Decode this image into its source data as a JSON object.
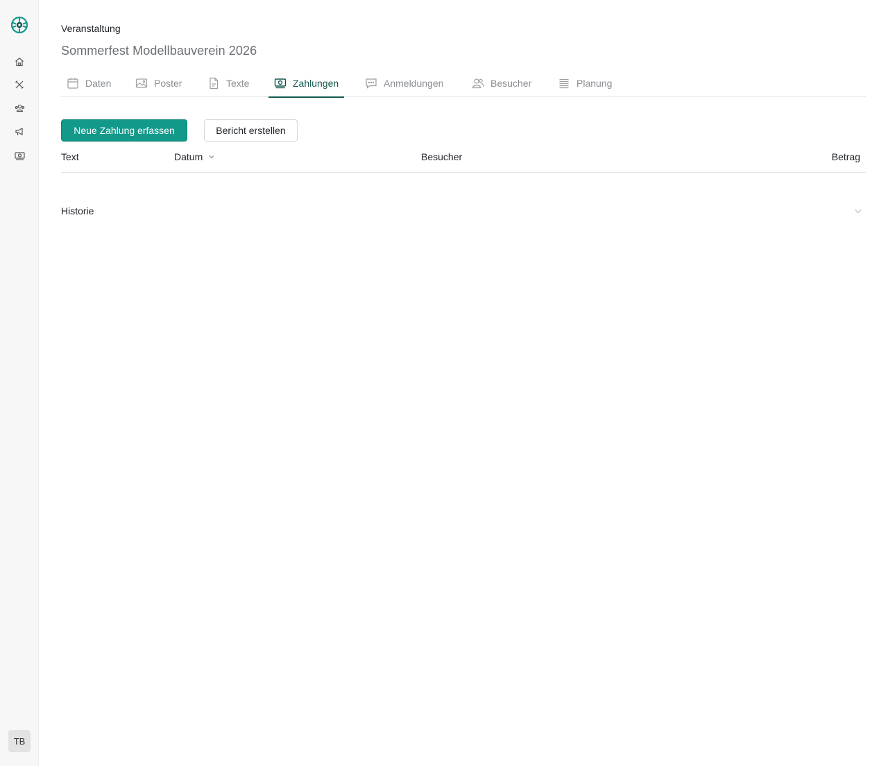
{
  "sidebar": {
    "logo": "brand-logo-icon",
    "nav": [
      {
        "name": "home-icon"
      },
      {
        "name": "tools-icon"
      },
      {
        "name": "users-icon"
      },
      {
        "name": "megaphone-icon"
      },
      {
        "name": "payments-icon"
      }
    ],
    "avatar_initials": "TB"
  },
  "header": {
    "eyebrow": "Veranstaltung",
    "title": "Sommerfest Modellbauverein 2026"
  },
  "tabs": [
    {
      "label": "Daten",
      "icon": "calendar-icon",
      "active": false
    },
    {
      "label": "Poster",
      "icon": "image-icon",
      "active": false
    },
    {
      "label": "Texte",
      "icon": "document-icon",
      "active": false
    },
    {
      "label": "Zahlungen",
      "icon": "money-icon",
      "active": true
    },
    {
      "label": "Anmeldungen",
      "icon": "chat-icon",
      "active": false
    },
    {
      "label": "Besucher",
      "icon": "people-icon",
      "active": false
    },
    {
      "label": "Planung",
      "icon": "list-icon",
      "active": false
    }
  ],
  "actions": {
    "primary_label": "Neue Zahlung erfassen",
    "secondary_label": "Bericht erstellen"
  },
  "table": {
    "columns": [
      "Text",
      "Datum",
      "Besucher",
      "Betrag"
    ],
    "rows": []
  },
  "history": {
    "label": "Historie"
  },
  "colors": {
    "accent": "#13998a",
    "active_tab": "#13594f"
  }
}
